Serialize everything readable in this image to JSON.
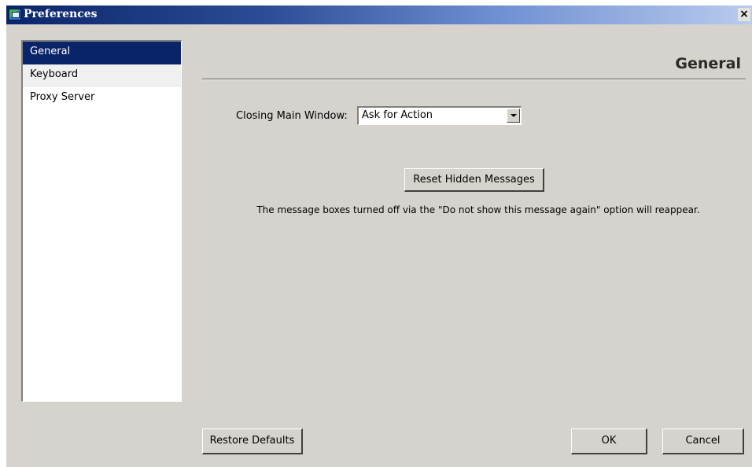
{
  "window": {
    "title": "Preferences",
    "close_label": "×"
  },
  "sidebar": {
    "items": [
      {
        "label": "General",
        "selected": true
      },
      {
        "label": "Keyboard",
        "selected": false
      },
      {
        "label": "Proxy Server",
        "selected": false
      }
    ]
  },
  "main": {
    "section_title": "General",
    "closing_main_window": {
      "label": "Closing Main Window:",
      "value": "Ask for Action"
    },
    "reset_button_label": "Reset Hidden Messages",
    "reset_description": "The message boxes turned off via the \"Do not show this message again\" option will reappear."
  },
  "footer": {
    "restore_label": "Restore Defaults",
    "ok_label": "OK",
    "cancel_label": "Cancel"
  },
  "colors": {
    "selection": "#0a246a",
    "dialog_bg": "#d6d3ce"
  },
  "icons": {
    "app": "preferences-app-icon",
    "close": "close-icon",
    "dropdown": "chevron-down-icon"
  }
}
